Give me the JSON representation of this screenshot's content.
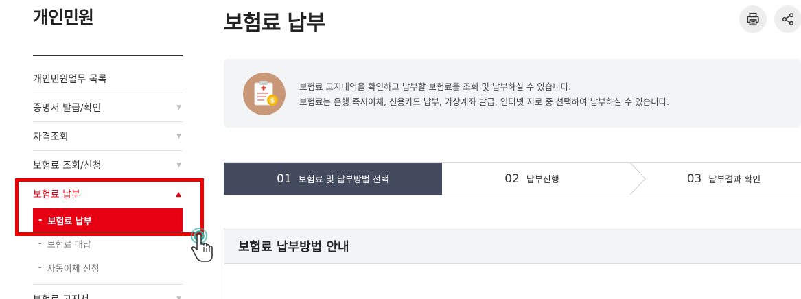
{
  "sidebar": {
    "title": "개인민원",
    "items": [
      {
        "label": "개인민원업무 목록",
        "chevron": ""
      },
      {
        "label": "증명서 발급/확인",
        "chevron": "▼"
      },
      {
        "label": "자격조회",
        "chevron": "▼"
      },
      {
        "label": "보험료 조회/신청",
        "chevron": "▼"
      }
    ],
    "active_item": {
      "label": "보험료 납부",
      "chevron": "▲"
    },
    "sub_items": [
      {
        "dash": "-",
        "label": "보험료 납부"
      },
      {
        "dash": "-",
        "label": "보험료 대납"
      },
      {
        "dash": "-",
        "label": "자동이체 신청"
      }
    ],
    "next_item": {
      "label": "보험료 고지서",
      "chevron": "▼"
    }
  },
  "main": {
    "title": "보험료 납부",
    "info": {
      "line1": "보험료 고지내역을 확인하고 납부할 보험료를 조회 및 납부하실 수 있습니다.",
      "line2": "보험료는 은행 즉시이체, 신용카드 납부, 가상계좌 발급, 인터넷 지로 중 선택하여 납부하실 수 있습니다."
    },
    "steps": [
      {
        "num": "01",
        "label": "보험료 및 납부방법 선택",
        "active": true
      },
      {
        "num": "02",
        "label": "납부진행",
        "active": false
      },
      {
        "num": "03",
        "label": "납부결과 확인",
        "active": false
      }
    ],
    "section_title": "보험료 납부방법 안내"
  },
  "colors": {
    "accent_red": "#e60012",
    "highlight_red": "#ec0000",
    "step_active_bg": "#454b5f",
    "info_bg": "#f3f4f6"
  },
  "icons": {
    "print": "print-icon",
    "share": "share-icon",
    "info": "clipboard-coin-icon",
    "cursor": "pointer-hand-icon"
  }
}
